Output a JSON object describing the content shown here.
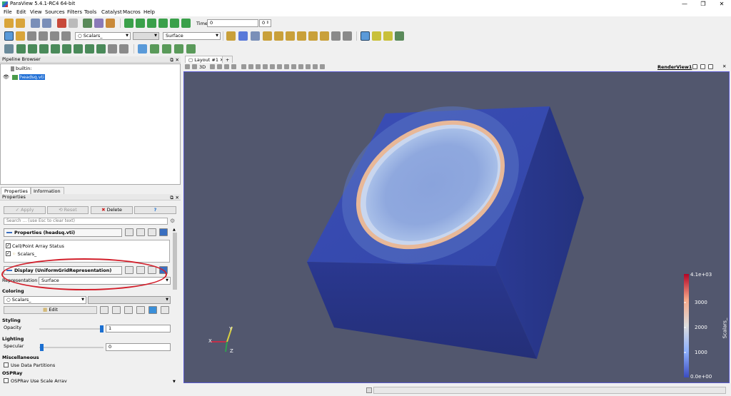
{
  "window": {
    "title": "ParaView 5.4.1-RC4 64-bit",
    "minimize": "—",
    "maximize": "❐",
    "close": "✕"
  },
  "menu": [
    "File",
    "Edit",
    "View",
    "Sources",
    "Filters",
    "Tools",
    "Catalyst",
    "Macros",
    "Help"
  ],
  "toolbar": {
    "time_label": "Time:",
    "time_value": "0",
    "time_step": "0",
    "color_array": "Scalars_",
    "component": "",
    "representation": "Surface"
  },
  "pipeline": {
    "header": "Pipeline Browser",
    "root": "builtin:",
    "source": "headsq.vti"
  },
  "tabs": [
    "Properties",
    "Information"
  ],
  "properties": {
    "header": "Properties",
    "apply": "Apply",
    "reset": "Reset",
    "delete": "Delete",
    "help": "?",
    "search_placeholder": "Search ... (use Esc to clear text)",
    "section_properties": "Properties (headsq.vti)",
    "cell_point_array_status": "Cell/Point Array Status",
    "array_item": "Scalars_",
    "section_display": "Display (UniformGridRepresentation)",
    "representation_label": "Representation",
    "representation_value": "Surface",
    "coloring_label": "Coloring",
    "coloring_array": "Scalars_",
    "edit": "Edit",
    "styling_label": "Styling",
    "opacity_label": "Opacity",
    "opacity_value": "1",
    "opacity_level": 1.0,
    "lighting_label": "Lighting",
    "specular_label": "Specular",
    "specular_value": "0",
    "specular_level": 0.0,
    "misc_label": "Miscellaneous",
    "use_data_partitions": "Use Data Partitions",
    "ospray_label": "OSPRay",
    "ospray_item": "OSPRay Use Scale Array"
  },
  "layout": {
    "tab": "Layout #1",
    "add_tab": "+",
    "render_view_label": "RenderView1",
    "mode_3d": "3D"
  },
  "axes": {
    "x": "X",
    "y": "Y",
    "z": "Z"
  },
  "colorbar": {
    "title": "Scalars_",
    "max_label": "4.1e+03",
    "min_label": "0.0e+00",
    "ticks": [
      "3000",
      "2000",
      "1000"
    ],
    "colors": [
      "#b40426",
      "#f7a889",
      "#dddddd",
      "#8db0fe",
      "#3b4cc0"
    ]
  },
  "colors": {
    "accent_blue": "#1b6fd1",
    "background": "#52576e",
    "annotation_red": "#d21e2a"
  }
}
